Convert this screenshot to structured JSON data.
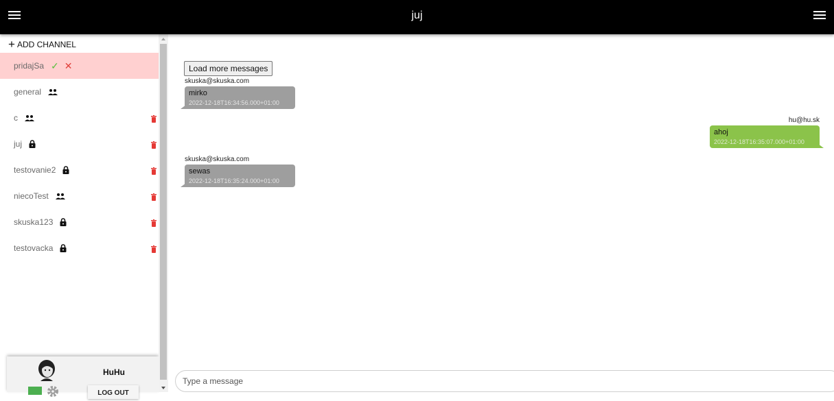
{
  "header": {
    "title": "juj"
  },
  "sidebar": {
    "add_channel": "ADD CHANNEL",
    "invite": {
      "label": "pridajSa",
      "accept": "✓",
      "decline": "✕"
    },
    "channels": [
      {
        "label": "general",
        "icon": "group-icon"
      },
      {
        "label": "c",
        "icon": "group-icon"
      },
      {
        "label": "juj",
        "icon": "lock-icon"
      },
      {
        "label": "testovanie2",
        "icon": "lock-icon"
      },
      {
        "label": "niecoTest",
        "icon": "group-icon"
      },
      {
        "label": "skuska123",
        "icon": "lock-icon"
      },
      {
        "label": "testovacka",
        "icon": "lock-icon"
      }
    ],
    "profile": {
      "nickname": "HuHu",
      "logout": "LOG OUT",
      "status_color": "#4caf50"
    }
  },
  "chat": {
    "load_more": "Load more messages",
    "messages": [
      {
        "sender": "skuska@skuska.com",
        "text": "mirko",
        "time": "2022-12-18T16:34:56.000+01:00",
        "own": false
      },
      {
        "sender": "hu@hu.sk",
        "text": "ahoj",
        "time": "2022-12-18T16:35:07.000+01:00",
        "own": true
      },
      {
        "sender": "skuska@skuska.com",
        "text": "sewas",
        "time": "2022-12-18T16:35:24.000+01:00",
        "own": false
      }
    ],
    "input_placeholder": "Type a message"
  },
  "colors": {
    "topbar": "#000000",
    "invite_bg": "#ffd0d0",
    "incoming_bubble": "#9e9e9e",
    "outgoing_bubble": "#8bc34a",
    "trash": "#e53935"
  }
}
